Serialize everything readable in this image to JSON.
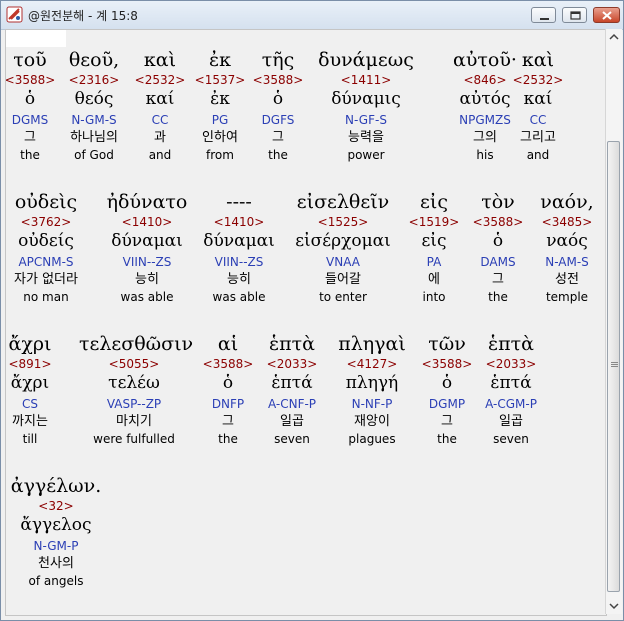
{
  "window": {
    "title": "@원전분해 - 계 15:8"
  },
  "verse_lines": [
    [
      {
        "greek": "τοῦ",
        "strong": "<3588>",
        "lemma": "ὁ",
        "parse": "DGMS",
        "korean": "그",
        "english": "the"
      },
      {
        "greek": "θεοῦ,",
        "strong": "<2316>",
        "lemma": "θεός",
        "parse": "N-GM-S",
        "korean": "하나님의",
        "english": "of God"
      },
      {
        "greek": "καὶ",
        "strong": "<2532>",
        "lemma": "καί",
        "parse": "CC",
        "korean": "과",
        "english": "and"
      },
      {
        "greek": "ἐκ",
        "strong": "<1537>",
        "lemma": "ἐκ",
        "parse": "PG",
        "korean": "인하여",
        "english": "from"
      },
      {
        "greek": "τῆς",
        "strong": "<3588>",
        "lemma": "ὁ",
        "parse": "DGFS",
        "korean": "그",
        "english": "the"
      },
      {
        "greek": "δυνάμεως",
        "strong": "<1411>",
        "lemma": "δύναμις",
        "parse": "N-GF-S",
        "korean": "능력을",
        "english": "power"
      },
      {
        "greek": "αὐτοῦ·",
        "strong": "<846>",
        "lemma": "αὐτός",
        "parse": "NPGMZS",
        "korean": "그의",
        "english": "his"
      },
      {
        "greek": "καὶ",
        "strong": "<2532>",
        "lemma": "καί",
        "parse": "CC",
        "korean": "그리고",
        "english": "and"
      }
    ],
    [
      {
        "greek": "οὐδεὶς",
        "strong": "<3762>",
        "lemma": "οὐδείς",
        "parse": "APCNM-S",
        "korean": "자가 없더라",
        "english": "no man"
      },
      {
        "greek": "ἠδύνατο",
        "strong": "<1410>",
        "lemma": "δύναμαι",
        "parse": "VIIN--ZS",
        "korean": "능히",
        "english": "was able"
      },
      {
        "greek": "----",
        "strong": "<1410>",
        "lemma": "δύναμαι",
        "parse": "VIIN--ZS",
        "korean": "능히",
        "english": "was able"
      },
      {
        "greek": "εἰσελθεῖν",
        "strong": "<1525>",
        "lemma": "εἰσέρχομαι",
        "parse": "VNAA",
        "korean": "들어갈",
        "english": "to enter"
      },
      {
        "greek": "εἰς",
        "strong": "<1519>",
        "lemma": "εἰς",
        "parse": "PA",
        "korean": "에",
        "english": "into"
      },
      {
        "greek": "τὸν",
        "strong": "<3588>",
        "lemma": "ὁ",
        "parse": "DAMS",
        "korean": "그",
        "english": "the"
      },
      {
        "greek": "ναόν,",
        "strong": "<3485>",
        "lemma": "ναός",
        "parse": "N-AM-S",
        "korean": "성전",
        "english": "temple"
      }
    ],
    [
      {
        "greek": "ἄχρι",
        "strong": "<891>",
        "lemma": "ἄχρι",
        "parse": "CS",
        "korean": "까지는",
        "english": "till"
      },
      {
        "greek": "τελεσθῶσιν",
        "strong": "<5055>",
        "lemma": "τελέω",
        "parse": "VASP--ZP",
        "korean": "마치기",
        "english": "were fulfulled"
      },
      {
        "greek": "αἱ",
        "strong": "<3588>",
        "lemma": "ὁ",
        "parse": "DNFP",
        "korean": "그",
        "english": "the"
      },
      {
        "greek": "ἑπτὰ",
        "strong": "<2033>",
        "lemma": "ἑπτά",
        "parse": "A-CNF-P",
        "korean": "일곱",
        "english": "seven"
      },
      {
        "greek": "πληγαὶ",
        "strong": "<4127>",
        "lemma": "πληγή",
        "parse": "N-NF-P",
        "korean": "재앙이",
        "english": "plagues"
      },
      {
        "greek": "τῶν",
        "strong": "<3588>",
        "lemma": "ὁ",
        "parse": "DGMP",
        "korean": "그",
        "english": "the"
      },
      {
        "greek": "ἑπτὰ",
        "strong": "<2033>",
        "lemma": "ἑπτά",
        "parse": "A-CGM-P",
        "korean": "일곱",
        "english": "seven"
      }
    ],
    [
      {
        "greek": "ἀγγέλων.",
        "strong": "<32>",
        "lemma": "ἄγγελος",
        "parse": "N-GM-P",
        "korean": "천사의",
        "english": "of angels"
      }
    ]
  ],
  "colors": {
    "strong": "#8b0000",
    "parse": "#2b3fb5",
    "text": "#000000"
  },
  "icons": {
    "app": "app-icon",
    "minimize": "minimize-icon",
    "maximize": "maximize-icon",
    "close": "close-icon"
  }
}
